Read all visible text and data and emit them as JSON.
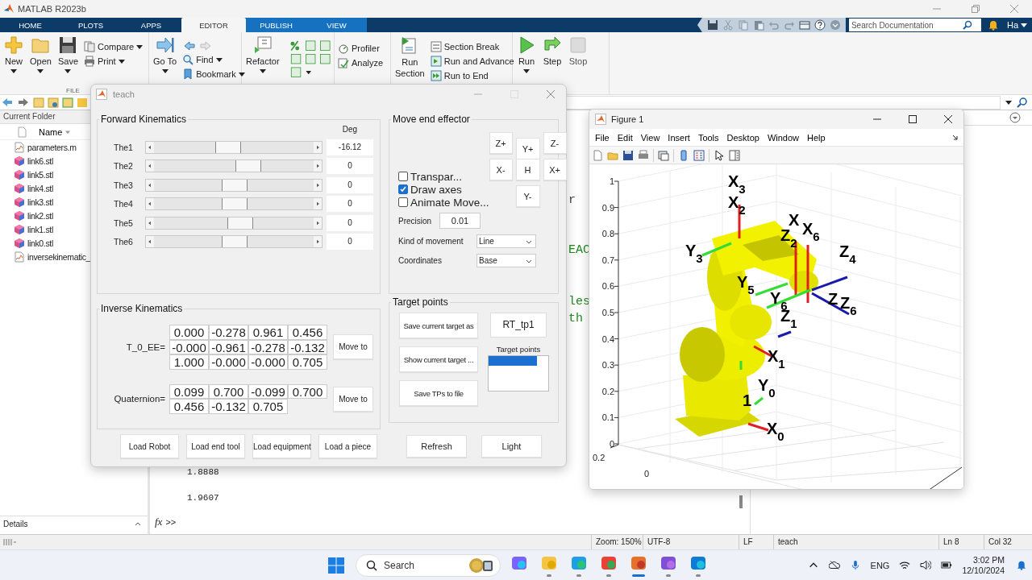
{
  "app": {
    "title": "MATLAB R2023b"
  },
  "tabs": [
    {
      "label": "HOME",
      "selected": false,
      "contextual": false
    },
    {
      "label": "PLOTS",
      "selected": false,
      "contextual": false
    },
    {
      "label": "APPS",
      "selected": false,
      "contextual": false
    },
    {
      "label": "EDITOR",
      "selected": true,
      "contextual": true
    },
    {
      "label": "PUBLISH",
      "selected": false,
      "contextual": true
    },
    {
      "label": "VIEW",
      "selected": false,
      "contextual": true
    }
  ],
  "search": {
    "placeholder": "Search Documentation"
  },
  "user": "Ha",
  "toolstrip": {
    "file": {
      "label": "FILE",
      "new": "New",
      "open": "Open",
      "save": "Save",
      "compare": "Compare",
      "print": "Print"
    },
    "navigate": {
      "go_to": "Go To",
      "find": "Find",
      "bookmark": "Bookmark"
    },
    "code": {
      "refactor": "Refactor"
    },
    "analyze": {
      "profiler": "Profiler",
      "analyze": "Analyze"
    },
    "section": {
      "run_section": "Run Section",
      "section_break": "Section Break",
      "run_and_advance": "Run and Advance",
      "run_to_end": "Run to End"
    },
    "run": {
      "run": "Run",
      "step": "Step",
      "stop": {
        "label": "Stop",
        "disabled": true
      }
    }
  },
  "current_folder": {
    "title": "Current Folder",
    "column": "Name",
    "details": "Details",
    "files": [
      {
        "name": "parameters.m",
        "kind": "script"
      },
      {
        "name": "link6.stl",
        "kind": "mesh"
      },
      {
        "name": "link5.stl",
        "kind": "mesh"
      },
      {
        "name": "link4.stl",
        "kind": "mesh"
      },
      {
        "name": "link3.stl",
        "kind": "mesh"
      },
      {
        "name": "link2.stl",
        "kind": "mesh"
      },
      {
        "name": "link1.stl",
        "kind": "mesh"
      },
      {
        "name": "link0.stl",
        "kind": "mesh"
      },
      {
        "name": "inversekinematic_",
        "kind": "script"
      }
    ]
  },
  "editor_fragments": [
    {
      "text": "r",
      "kind": "code"
    },
    {
      "text": "EAC",
      "kind": "comment"
    },
    {
      "text": "les",
      "kind": "comment"
    },
    {
      "text": "th",
      "kind": "comment"
    }
  ],
  "command_window": {
    "lines": [
      "1.8888",
      "1.9607"
    ],
    "function_label": "fx",
    "prompt": ">>"
  },
  "teach": {
    "title": "teach",
    "forward": {
      "title": "Forward Kinematics",
      "unit": "Deg",
      "joints": [
        {
          "label": "The1",
          "level": 0.45,
          "value": "-16.12"
        },
        {
          "label": "The2",
          "level": 0.6,
          "value": "0"
        },
        {
          "label": "The3",
          "level": 0.5,
          "value": "0"
        },
        {
          "label": "The4",
          "level": 0.5,
          "value": "0"
        },
        {
          "label": "The5",
          "level": 0.54,
          "value": "0"
        },
        {
          "label": "The6",
          "level": 0.5,
          "value": "0"
        }
      ]
    },
    "move": {
      "title": "Move end effector",
      "jog": [
        "Z+",
        "Y+",
        "Z-",
        "X-",
        "H",
        "X+",
        "Y-"
      ],
      "options": [
        {
          "label": "Transpar...",
          "checked": false
        },
        {
          "label": "Draw axes",
          "checked": true
        },
        {
          "label": "Animate Move...",
          "checked": false
        }
      ],
      "precision": {
        "label": "Precision",
        "value": "0.01"
      },
      "movement": {
        "label": "Kind of movement",
        "value": "Line"
      },
      "coordinates": {
        "label": "Coordinates",
        "value": "Base"
      }
    },
    "inverse": {
      "title": "Inverse Kinematics",
      "transform": {
        "label": "T_0_EE=",
        "button": "Move to",
        "rows": [
          [
            "0.000",
            "-0.278",
            "0.961",
            "0.456"
          ],
          [
            "-0.000",
            "-0.961",
            "-0.278",
            "-0.132"
          ],
          [
            "1.000",
            "-0.000",
            "-0.000",
            "0.705"
          ]
        ]
      },
      "quaternion": {
        "label": "Quaternion=",
        "button": "Move to",
        "rows": [
          [
            "0.099",
            "0.700",
            "-0.099",
            "0.700"
          ],
          [
            "0.456",
            "-0.132",
            "0.705"
          ]
        ]
      }
    },
    "target": {
      "title": "Target points",
      "save": "Save current target as",
      "show": "Show current target ...",
      "save_file": "Save TPs to file",
      "name": "RT_tp1",
      "list_label": "Target points",
      "list": [
        {
          "selected": true
        }
      ]
    },
    "load_buttons": [
      "Load Robot",
      "Load end tool",
      "Load equipment",
      "Load a piece"
    ],
    "refresh": "Refresh",
    "light": "Light"
  },
  "figure": {
    "title": "Figure 1",
    "menu": [
      "File",
      "Edit",
      "View",
      "Insert",
      "Tools",
      "Desktop",
      "Window",
      "Help"
    ],
    "yticks": [
      "1",
      "0.9",
      "0.8",
      "0.7",
      "0.6",
      "0.5",
      "0.4",
      "0.3",
      "0.2",
      "0.1",
      "0"
    ],
    "xticks": [
      "0.2",
      "0"
    ],
    "frame_labels": [
      "X$_{3}$",
      "X$_{2}$",
      "X",
      "X$_{6}$",
      "Z$_{2}$",
      "Y$_{3}$",
      "Z$_{4}$",
      "Y$_{5}$",
      "Y$_{6}$",
      "Z",
      "Z$_{6}$",
      "Z$_{1}$",
      "X$_{1}$",
      "1",
      "Y$_{0}$",
      "X$_{0}$"
    ]
  },
  "status_bar": {
    "zoom": "Zoom: 150%",
    "encoding": "UTF-8",
    "line_ending": "LF",
    "file": "teach",
    "line": "Ln 8",
    "column": "Col 32"
  },
  "taskbar": {
    "search": "Search",
    "language": "ENG",
    "time": "3:02 PM",
    "date": "12/10/2024",
    "apps": [
      {
        "running": false,
        "active": false
      },
      {
        "running": true,
        "active": false
      },
      {
        "running": true,
        "active": false
      },
      {
        "running": true,
        "active": false
      },
      {
        "running": true,
        "active": true
      },
      {
        "running": true,
        "active": false
      },
      {
        "running": true,
        "active": false
      }
    ]
  }
}
